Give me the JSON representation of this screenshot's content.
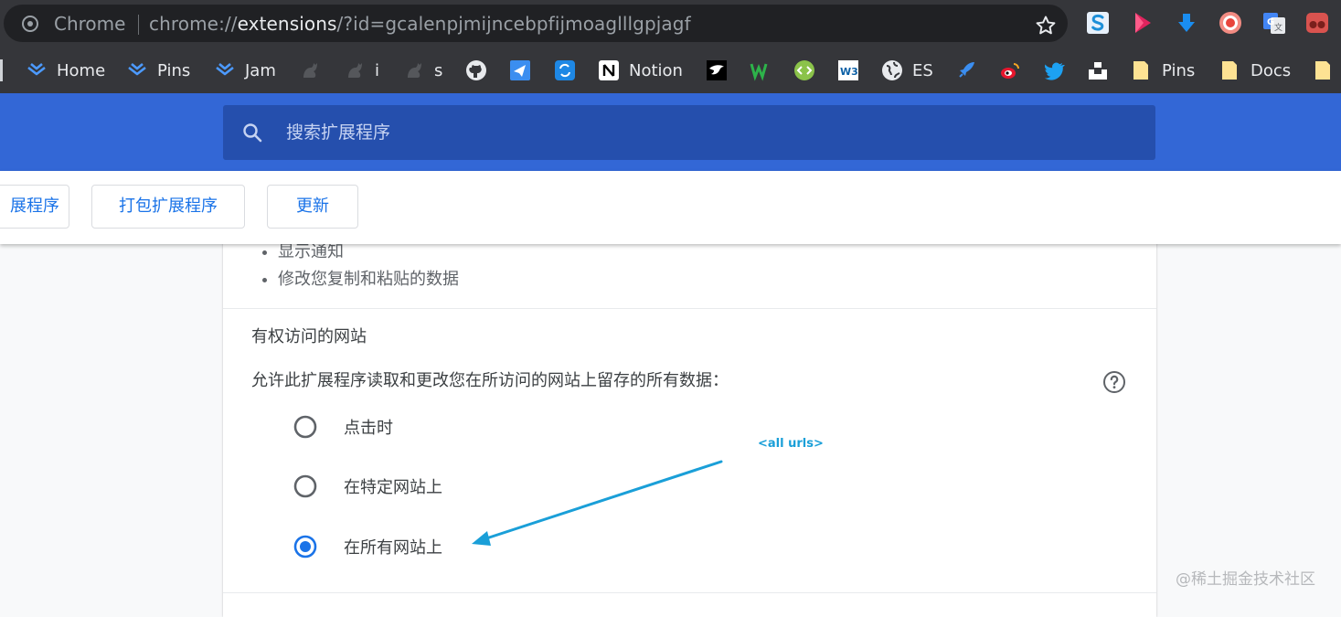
{
  "omnibox": {
    "site_label": "Chrome",
    "url_scheme": "chrome://",
    "url_host": "extensions",
    "url_rest": "/?id=gcalenpjmijncebpfijmoaglllgpjagf"
  },
  "toolbar_icons": [
    {
      "name": "s-extension-icon",
      "color": "#1d8fd8"
    },
    {
      "name": "play-extension-icon",
      "color": "#e0245e"
    },
    {
      "name": "download-arrow-icon",
      "color": "#1a8df0"
    },
    {
      "name": "record-circle-icon",
      "color": "#f28b82"
    },
    {
      "name": "google-translate-icon",
      "color": "#4285f4"
    },
    {
      "name": "incognito-mask-icon",
      "color": "#d9534f"
    }
  ],
  "bookmarks": [
    {
      "label": "Home",
      "icon": "jira-icon"
    },
    {
      "label": "Pins",
      "icon": "jira-icon"
    },
    {
      "label": "Jam",
      "icon": "jira-icon"
    },
    {
      "label": "",
      "icon": "cat-icon"
    },
    {
      "label": "i",
      "icon": "cat-icon"
    },
    {
      "label": "s",
      "icon": "cat-icon"
    },
    {
      "label": "",
      "icon": "github-icon"
    },
    {
      "label": "",
      "icon": "send-icon"
    },
    {
      "label": "",
      "icon": "sync-icon"
    },
    {
      "label": "Notion",
      "icon": "notion-icon"
    },
    {
      "label": "",
      "icon": "bird-icon"
    },
    {
      "label": "",
      "icon": "w-icon"
    },
    {
      "label": "",
      "icon": "code-icon"
    },
    {
      "label": "",
      "icon": "w3-icon"
    },
    {
      "label": "ES",
      "icon": "globe-icon"
    },
    {
      "label": "",
      "icon": "rocket-icon"
    },
    {
      "label": "",
      "icon": "weibo-icon"
    },
    {
      "label": "",
      "icon": "twitter-icon"
    },
    {
      "label": "",
      "icon": "unsplash-icon"
    },
    {
      "label": "Pins",
      "icon": "folder-icon"
    },
    {
      "label": "Docs",
      "icon": "folder-icon"
    },
    {
      "label": "",
      "icon": "folder-icon"
    }
  ],
  "search": {
    "placeholder": "搜索扩展程序"
  },
  "toolbar": {
    "load_unpacked": "展程序",
    "pack_extension": "打包扩展程序",
    "update": "更新"
  },
  "permissions": {
    "items": [
      "显示通知",
      "修改您复制和粘贴的数据"
    ]
  },
  "site_access": {
    "title": "有权访问的网站",
    "description": "允许此扩展程序读取和更改您在所访问的网站上留存的所有数据：",
    "options": [
      {
        "label": "点击时",
        "selected": false
      },
      {
        "label": "在特定网站上",
        "selected": false
      },
      {
        "label": "在所有网站上",
        "selected": true
      }
    ]
  },
  "annotation": {
    "text": "<all urls>",
    "color": "#1a9fd8"
  },
  "watermark": "@稀土掘金技术社区",
  "colors": {
    "header_blue": "#3367d6",
    "search_bg": "#254fad",
    "accent_blue": "#1a73e8",
    "chrome_dark": "#35363a"
  }
}
